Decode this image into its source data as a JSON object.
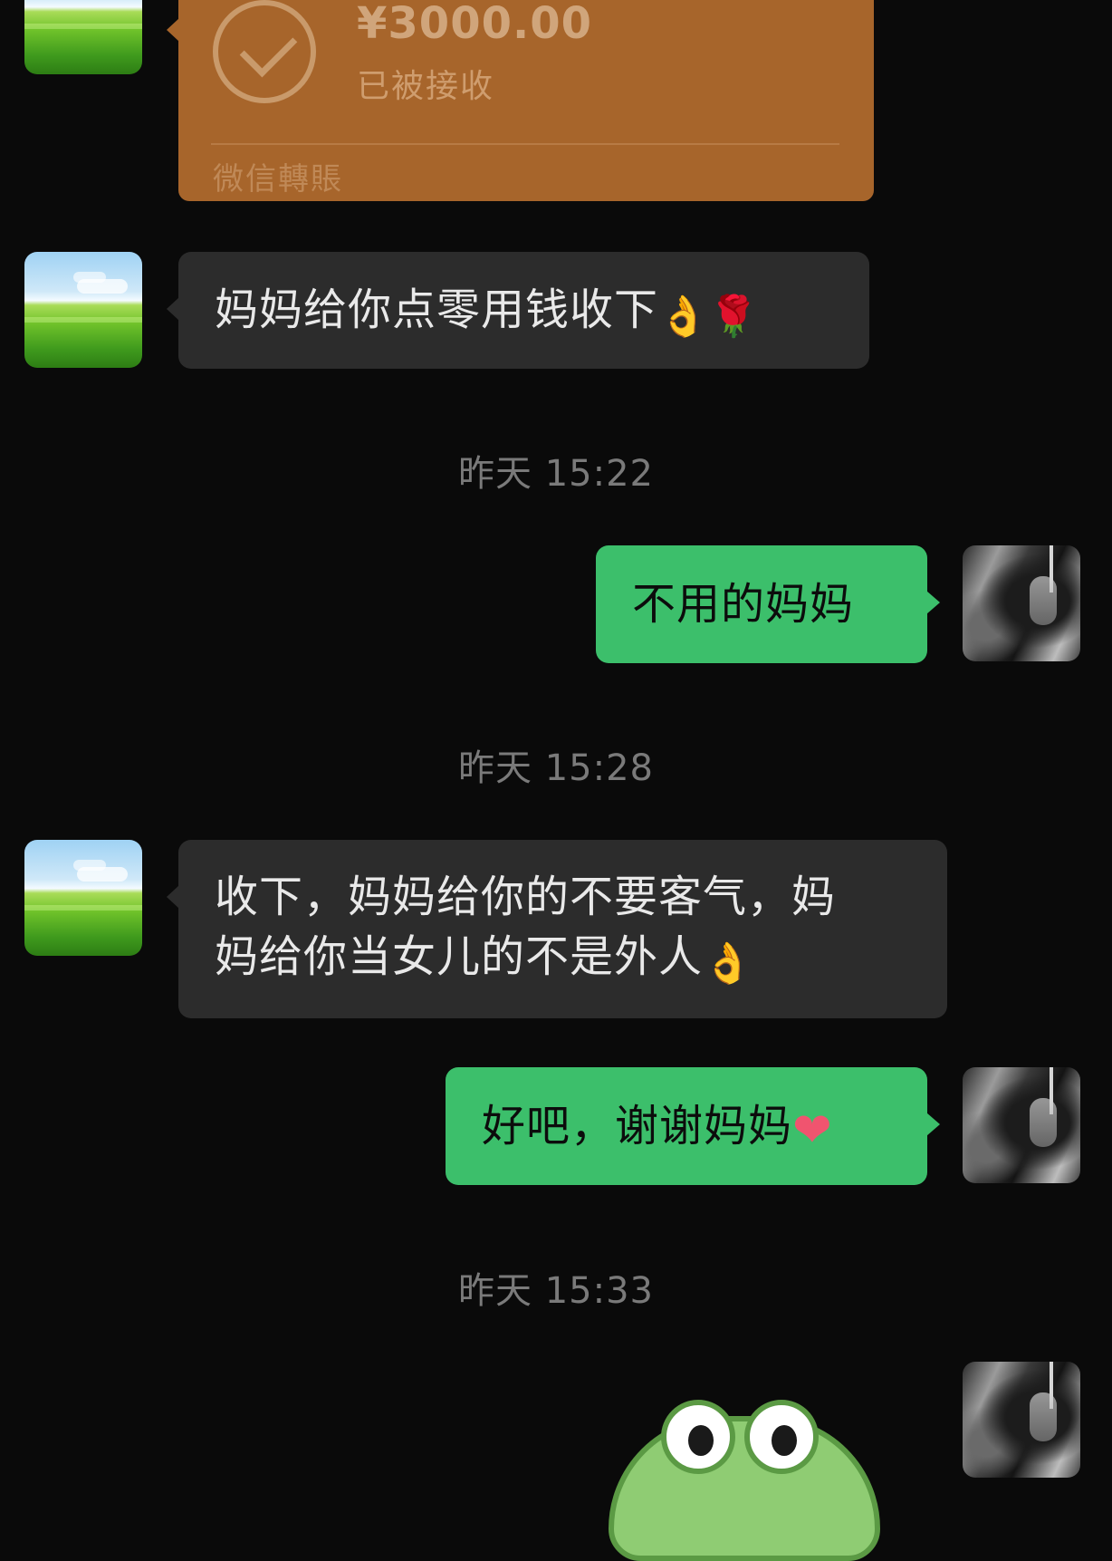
{
  "transfer": {
    "amount": "¥3000.00",
    "status": "已被接收",
    "label": "微信轉賬"
  },
  "messages": [
    {
      "side": "in",
      "text": "妈妈给你点零用钱收下",
      "emojis": [
        "hand-emoji",
        "rose-emoji"
      ]
    },
    {
      "side": "out",
      "text": "不用的妈妈"
    },
    {
      "side": "in",
      "line1": "收下，妈妈给你的不要客气，妈",
      "line2": "妈给你当女儿的不是外人",
      "emojis": [
        "hand-emoji"
      ]
    },
    {
      "side": "out",
      "text": "好吧，谢谢妈妈",
      "emojis": [
        "heart-emoji"
      ]
    }
  ],
  "timestamps": [
    "昨天 15:22",
    "昨天 15:28",
    "昨天 15:33"
  ],
  "colors": {
    "background": "#0a0a0a",
    "incoming_bubble": "#2c2c2c",
    "outgoing_bubble": "#3cbf6b",
    "transfer_card": "#a7652b",
    "timestamp_text": "#7a7a7a"
  },
  "icons": {
    "transfer_status": "check-circle-icon",
    "sticker": "frog-sticker"
  }
}
